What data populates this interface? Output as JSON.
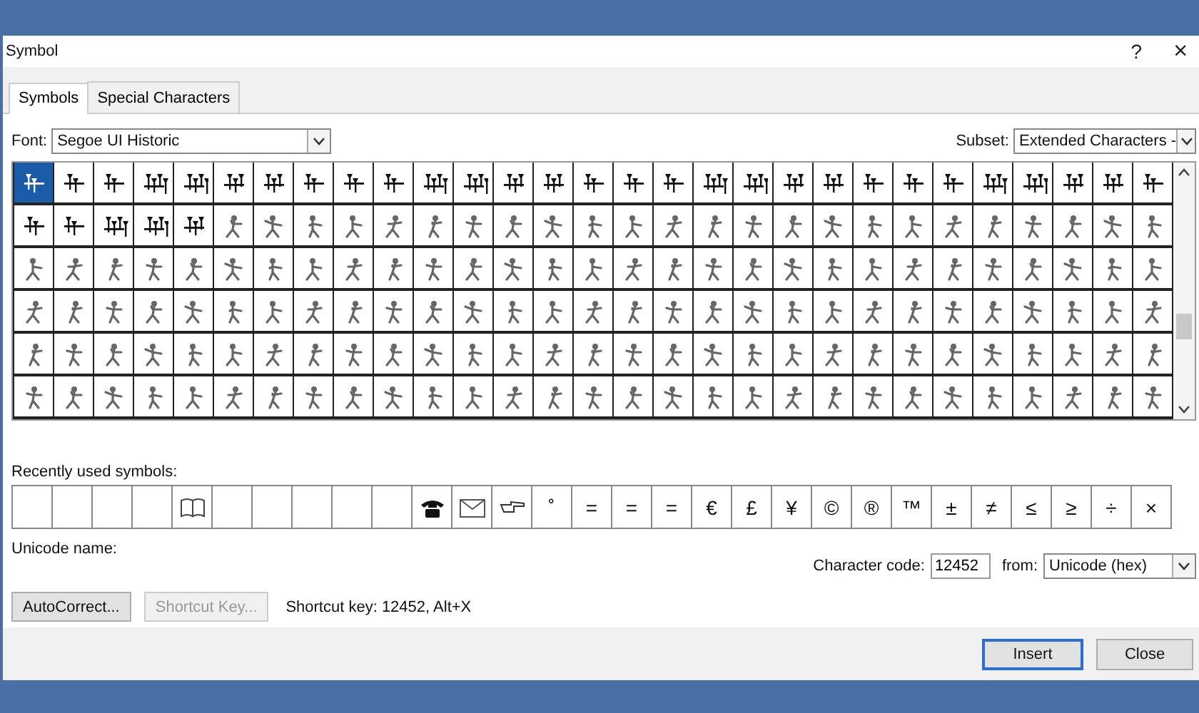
{
  "window": {
    "title": "Symbol",
    "help": "?",
    "close": "×"
  },
  "tabs": [
    {
      "label": "Symbols",
      "selected": true
    },
    {
      "label": "Special Characters",
      "selected": false
    }
  ],
  "font": {
    "label": "Font:",
    "value": "Segoe UI Historic"
  },
  "subset": {
    "label": "Subset:",
    "value": "Extended Characters -"
  },
  "symbol_grid": {
    "rows": [
      [
        {
          "kind": "cuneiform",
          "selected": true
        },
        {
          "kind": "cuneiform",
          "selected": false
        },
        {
          "kind": "cuneiform",
          "selected": false
        },
        {
          "kind": "cuneiform",
          "selected": false
        },
        {
          "kind": "cuneiform",
          "selected": false
        },
        {
          "kind": "cuneiform",
          "selected": false
        },
        {
          "kind": "cuneiform",
          "selected": false
        },
        {
          "kind": "cuneiform",
          "selected": false
        },
        {
          "kind": "cuneiform",
          "selected": false
        },
        {
          "kind": "cuneiform",
          "selected": false
        },
        {
          "kind": "cuneiform",
          "selected": false
        },
        {
          "kind": "cuneiform",
          "selected": false
        },
        {
          "kind": "cuneiform",
          "selected": false
        },
        {
          "kind": "cuneiform",
          "selected": false
        },
        {
          "kind": "cuneiform",
          "selected": false
        },
        {
          "kind": "cuneiform",
          "selected": false
        },
        {
          "kind": "cuneiform",
          "selected": false
        },
        {
          "kind": "cuneiform",
          "selected": false
        },
        {
          "kind": "cuneiform",
          "selected": false
        },
        {
          "kind": "cuneiform",
          "selected": false
        },
        {
          "kind": "cuneiform",
          "selected": false
        },
        {
          "kind": "cuneiform",
          "selected": false
        },
        {
          "kind": "cuneiform",
          "selected": false
        },
        {
          "kind": "cuneiform",
          "selected": false
        },
        {
          "kind": "cuneiform",
          "selected": false
        },
        {
          "kind": "cuneiform",
          "selected": false
        },
        {
          "kind": "cuneiform",
          "selected": false
        },
        {
          "kind": "cuneiform",
          "selected": false
        },
        {
          "kind": "cuneiform",
          "selected": false
        }
      ],
      [
        {
          "kind": "cuneiform",
          "selected": false
        },
        {
          "kind": "cuneiform",
          "selected": false
        },
        {
          "kind": "cuneiform",
          "selected": false
        },
        {
          "kind": "cuneiform",
          "selected": false
        },
        {
          "kind": "cuneiform",
          "selected": false
        },
        {
          "kind": "hieroglyph",
          "selected": false
        },
        {
          "kind": "hieroglyph",
          "selected": false
        },
        {
          "kind": "hieroglyph",
          "selected": false
        },
        {
          "kind": "hieroglyph",
          "selected": false
        },
        {
          "kind": "hieroglyph",
          "selected": false
        },
        {
          "kind": "hieroglyph",
          "selected": false
        },
        {
          "kind": "hieroglyph",
          "selected": false
        },
        {
          "kind": "hieroglyph",
          "selected": false
        },
        {
          "kind": "hieroglyph",
          "selected": false
        },
        {
          "kind": "hieroglyph",
          "selected": false
        },
        {
          "kind": "hieroglyph",
          "selected": false
        },
        {
          "kind": "hieroglyph",
          "selected": false
        },
        {
          "kind": "hieroglyph",
          "selected": false
        },
        {
          "kind": "hieroglyph",
          "selected": false
        },
        {
          "kind": "hieroglyph",
          "selected": false
        },
        {
          "kind": "hieroglyph",
          "selected": false
        },
        {
          "kind": "hieroglyph",
          "selected": false
        },
        {
          "kind": "hieroglyph",
          "selected": false
        },
        {
          "kind": "hieroglyph",
          "selected": false
        },
        {
          "kind": "hieroglyph",
          "selected": false
        },
        {
          "kind": "hieroglyph",
          "selected": false
        },
        {
          "kind": "hieroglyph",
          "selected": false
        },
        {
          "kind": "hieroglyph",
          "selected": false
        },
        {
          "kind": "hieroglyph",
          "selected": false
        }
      ],
      [
        {
          "kind": "hieroglyph",
          "selected": false
        },
        {
          "kind": "hieroglyph",
          "selected": false
        },
        {
          "kind": "hieroglyph",
          "selected": false
        },
        {
          "kind": "hieroglyph",
          "selected": false
        },
        {
          "kind": "hieroglyph",
          "selected": false
        },
        {
          "kind": "hieroglyph",
          "selected": false
        },
        {
          "kind": "hieroglyph",
          "selected": false
        },
        {
          "kind": "hieroglyph",
          "selected": false
        },
        {
          "kind": "hieroglyph",
          "selected": false
        },
        {
          "kind": "hieroglyph",
          "selected": false
        },
        {
          "kind": "hieroglyph",
          "selected": false
        },
        {
          "kind": "hieroglyph",
          "selected": false
        },
        {
          "kind": "hieroglyph",
          "selected": false
        },
        {
          "kind": "hieroglyph",
          "selected": false
        },
        {
          "kind": "hieroglyph",
          "selected": false
        },
        {
          "kind": "hieroglyph",
          "selected": false
        },
        {
          "kind": "hieroglyph",
          "selected": false
        },
        {
          "kind": "hieroglyph",
          "selected": false
        },
        {
          "kind": "hieroglyph",
          "selected": false
        },
        {
          "kind": "hieroglyph",
          "selected": false
        },
        {
          "kind": "hieroglyph",
          "selected": false
        },
        {
          "kind": "hieroglyph",
          "selected": false
        },
        {
          "kind": "hieroglyph",
          "selected": false
        },
        {
          "kind": "hieroglyph",
          "selected": false
        },
        {
          "kind": "hieroglyph",
          "selected": false
        },
        {
          "kind": "hieroglyph",
          "selected": false
        },
        {
          "kind": "hieroglyph",
          "selected": false
        },
        {
          "kind": "hieroglyph",
          "selected": false
        },
        {
          "kind": "hieroglyph",
          "selected": false
        }
      ],
      [
        {
          "kind": "hieroglyph",
          "selected": false
        },
        {
          "kind": "hieroglyph",
          "selected": false
        },
        {
          "kind": "hieroglyph",
          "selected": false
        },
        {
          "kind": "hieroglyph",
          "selected": false
        },
        {
          "kind": "hieroglyph",
          "selected": false
        },
        {
          "kind": "hieroglyph",
          "selected": false
        },
        {
          "kind": "hieroglyph",
          "selected": false
        },
        {
          "kind": "hieroglyph",
          "selected": false
        },
        {
          "kind": "hieroglyph",
          "selected": false
        },
        {
          "kind": "hieroglyph",
          "selected": false
        },
        {
          "kind": "hieroglyph",
          "selected": false
        },
        {
          "kind": "hieroglyph",
          "selected": false
        },
        {
          "kind": "hieroglyph",
          "selected": false
        },
        {
          "kind": "hieroglyph",
          "selected": false
        },
        {
          "kind": "hieroglyph",
          "selected": false
        },
        {
          "kind": "hieroglyph",
          "selected": false
        },
        {
          "kind": "hieroglyph",
          "selected": false
        },
        {
          "kind": "hieroglyph",
          "selected": false
        },
        {
          "kind": "hieroglyph",
          "selected": false
        },
        {
          "kind": "hieroglyph",
          "selected": false
        },
        {
          "kind": "hieroglyph",
          "selected": false
        },
        {
          "kind": "hieroglyph",
          "selected": false
        },
        {
          "kind": "hieroglyph",
          "selected": false
        },
        {
          "kind": "hieroglyph",
          "selected": false
        },
        {
          "kind": "hieroglyph",
          "selected": false
        },
        {
          "kind": "hieroglyph",
          "selected": false
        },
        {
          "kind": "hieroglyph",
          "selected": false
        },
        {
          "kind": "hieroglyph",
          "selected": false
        },
        {
          "kind": "hieroglyph",
          "selected": false
        }
      ],
      [
        {
          "kind": "hieroglyph",
          "selected": false
        },
        {
          "kind": "hieroglyph",
          "selected": false
        },
        {
          "kind": "hieroglyph",
          "selected": false
        },
        {
          "kind": "hieroglyph",
          "selected": false
        },
        {
          "kind": "hieroglyph",
          "selected": false
        },
        {
          "kind": "hieroglyph",
          "selected": false
        },
        {
          "kind": "hieroglyph",
          "selected": false
        },
        {
          "kind": "hieroglyph",
          "selected": false
        },
        {
          "kind": "hieroglyph",
          "selected": false
        },
        {
          "kind": "hieroglyph",
          "selected": false
        },
        {
          "kind": "hieroglyph",
          "selected": false
        },
        {
          "kind": "hieroglyph",
          "selected": false
        },
        {
          "kind": "hieroglyph",
          "selected": false
        },
        {
          "kind": "hieroglyph",
          "selected": false
        },
        {
          "kind": "hieroglyph",
          "selected": false
        },
        {
          "kind": "hieroglyph",
          "selected": false
        },
        {
          "kind": "hieroglyph",
          "selected": false
        },
        {
          "kind": "hieroglyph",
          "selected": false
        },
        {
          "kind": "hieroglyph",
          "selected": false
        },
        {
          "kind": "hieroglyph",
          "selected": false
        },
        {
          "kind": "hieroglyph",
          "selected": false
        },
        {
          "kind": "hieroglyph",
          "selected": false
        },
        {
          "kind": "hieroglyph",
          "selected": false
        },
        {
          "kind": "hieroglyph",
          "selected": false
        },
        {
          "kind": "hieroglyph",
          "selected": false
        },
        {
          "kind": "hieroglyph",
          "selected": false
        },
        {
          "kind": "hieroglyph",
          "selected": false
        },
        {
          "kind": "hieroglyph",
          "selected": false
        },
        {
          "kind": "hieroglyph",
          "selected": false
        }
      ],
      [
        {
          "kind": "hieroglyph",
          "selected": false
        },
        {
          "kind": "hieroglyph",
          "selected": false
        },
        {
          "kind": "hieroglyph",
          "selected": false
        },
        {
          "kind": "hieroglyph",
          "selected": false
        },
        {
          "kind": "hieroglyph",
          "selected": false
        },
        {
          "kind": "hieroglyph",
          "selected": false
        },
        {
          "kind": "hieroglyph",
          "selected": false
        },
        {
          "kind": "hieroglyph",
          "selected": false
        },
        {
          "kind": "hieroglyph",
          "selected": false
        },
        {
          "kind": "hieroglyph",
          "selected": false
        },
        {
          "kind": "hieroglyph",
          "selected": false
        },
        {
          "kind": "hieroglyph",
          "selected": false
        },
        {
          "kind": "hieroglyph",
          "selected": false
        },
        {
          "kind": "hieroglyph",
          "selected": false
        },
        {
          "kind": "hieroglyph",
          "selected": false
        },
        {
          "kind": "hieroglyph",
          "selected": false
        },
        {
          "kind": "hieroglyph",
          "selected": false
        },
        {
          "kind": "hieroglyph",
          "selected": false
        },
        {
          "kind": "hieroglyph",
          "selected": false
        },
        {
          "kind": "hieroglyph",
          "selected": false
        },
        {
          "kind": "hieroglyph",
          "selected": false
        },
        {
          "kind": "hieroglyph",
          "selected": false
        },
        {
          "kind": "hieroglyph",
          "selected": false
        },
        {
          "kind": "hieroglyph",
          "selected": false
        },
        {
          "kind": "hieroglyph",
          "selected": false
        },
        {
          "kind": "hieroglyph",
          "selected": false
        },
        {
          "kind": "hieroglyph",
          "selected": false
        },
        {
          "kind": "hieroglyph",
          "selected": false
        },
        {
          "kind": "hieroglyph",
          "selected": false
        }
      ]
    ]
  },
  "recent": {
    "label": "Recently used symbols:",
    "items": [
      {
        "kind": "blank"
      },
      {
        "kind": "blank"
      },
      {
        "kind": "blank"
      },
      {
        "kind": "blank"
      },
      {
        "kind": "book"
      },
      {
        "kind": "blank"
      },
      {
        "kind": "blank"
      },
      {
        "kind": "blank"
      },
      {
        "kind": "blank"
      },
      {
        "kind": "blank"
      },
      {
        "kind": "telephone"
      },
      {
        "kind": "envelope"
      },
      {
        "kind": "hand"
      },
      {
        "kind": "text",
        "symbol": "˚"
      },
      {
        "kind": "text",
        "symbol": "="
      },
      {
        "kind": "text",
        "symbol": "="
      },
      {
        "kind": "text",
        "symbol": "="
      },
      {
        "kind": "text",
        "symbol": "€"
      },
      {
        "kind": "text",
        "symbol": "£"
      },
      {
        "kind": "text",
        "symbol": "¥"
      },
      {
        "kind": "text",
        "symbol": "©"
      },
      {
        "kind": "text",
        "symbol": "®"
      },
      {
        "kind": "text",
        "symbol": "™"
      },
      {
        "kind": "text",
        "symbol": "±"
      },
      {
        "kind": "text",
        "symbol": "≠"
      },
      {
        "kind": "text",
        "symbol": "≤"
      },
      {
        "kind": "text",
        "symbol": "≥"
      },
      {
        "kind": "text",
        "symbol": "÷"
      },
      {
        "kind": "text",
        "symbol": "×"
      }
    ]
  },
  "unicode_name": {
    "label": "Unicode name:"
  },
  "character_code": {
    "label": "Character code:",
    "value": "12452"
  },
  "from": {
    "label": "from:",
    "value": "Unicode (hex)"
  },
  "buttons": [
    {
      "label": "AutoCorrect...",
      "disabled": false
    },
    {
      "label": "Shortcut Key...",
      "disabled": true
    }
  ],
  "shortcut_text": "Shortcut key: 12452, Alt+X",
  "footer_buttons": [
    {
      "label": "Insert",
      "default": true
    },
    {
      "label": "Close",
      "default": false
    }
  ]
}
